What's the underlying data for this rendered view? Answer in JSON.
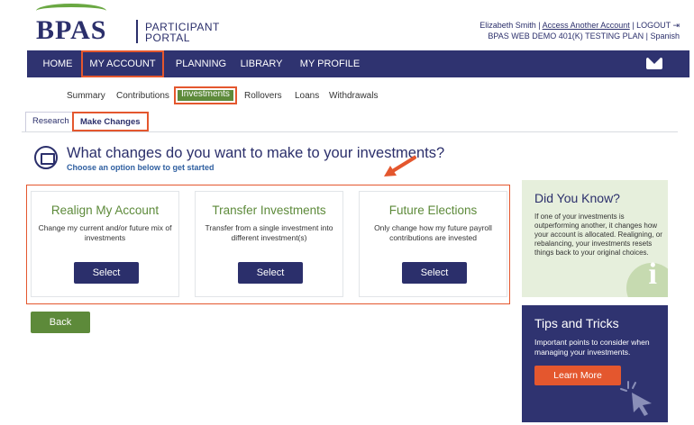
{
  "brand": {
    "logo_text": "BPAS",
    "logo_sub_line1": "PARTICIPANT",
    "logo_sub_line2": "PORTAL",
    "accent": "#6aa842",
    "navy": "#2f3370"
  },
  "account_bar": {
    "user": "Elizabeth Smith",
    "sep1": "|",
    "access_link": "Access Another Account",
    "sep2": "|",
    "logout": "LOGOUT",
    "plan": "BPAS WEB DEMO 401(K) TESTING PLAN",
    "sep3": "|",
    "language": "Spanish"
  },
  "nav": {
    "items": [
      {
        "label": "HOME"
      },
      {
        "label": "MY ACCOUNT"
      },
      {
        "label": "PLANNING"
      },
      {
        "label": "LIBRARY"
      },
      {
        "label": "MY PROFILE"
      }
    ]
  },
  "subnav": {
    "items": [
      {
        "label": "Summary"
      },
      {
        "label": "Contributions"
      },
      {
        "label": "Investments"
      },
      {
        "label": "Rollovers"
      },
      {
        "label": "Loans"
      },
      {
        "label": "Withdrawals"
      }
    ]
  },
  "tabs": [
    {
      "label": "Research"
    },
    {
      "label": "Make Changes"
    }
  ],
  "main": {
    "heading": "What changes do you want to make to your investments?",
    "subheading": "Choose an option below to get started"
  },
  "cards": [
    {
      "title": "Realign My Account",
      "desc": "Change my current and/or future mix of investments",
      "button": "Select"
    },
    {
      "title": "Transfer Investments",
      "desc": "Transfer from a single investment into different investment(s)",
      "button": "Select"
    },
    {
      "title": "Future Elections",
      "desc": "Only change how my future payroll contributions are invested",
      "button": "Select"
    }
  ],
  "back_button": "Back",
  "did_you_know": {
    "title": "Did You Know?",
    "text": "If one of your investments is outperforming another, it changes how your account is allocated. Realigning, or rebalancing, your investments resets things back to your original choices."
  },
  "tips": {
    "title": "Tips and Tricks",
    "text": "Important points to consider when managing your investments.",
    "button": "Learn More"
  }
}
